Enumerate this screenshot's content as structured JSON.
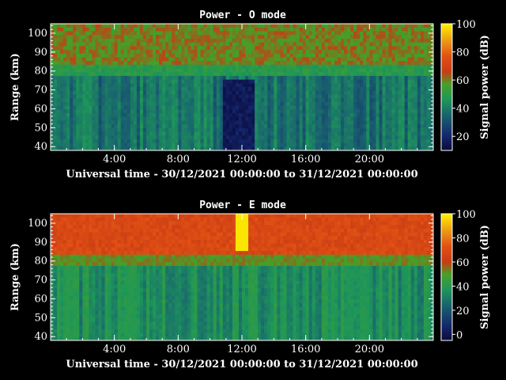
{
  "chart_data": [
    {
      "type": "heatmap",
      "title": "Power - O mode",
      "xlabel": "Universal time - 30/12/2021 00:00:00 to 31/12/2021 00:00:00",
      "ylabel": "Range (km)",
      "colorbar_label": "Signal power (dB)",
      "x_ticks": [
        "4:00",
        "8:00",
        "12:00",
        "16:00",
        "20:00"
      ],
      "x_tick_hours": [
        4,
        8,
        12,
        16,
        20
      ],
      "xlim_hours": [
        0,
        24
      ],
      "y_ticks": [
        40,
        50,
        60,
        70,
        80,
        90,
        100
      ],
      "ylim": [
        38,
        105
      ],
      "clim": [
        10,
        100
      ],
      "colorbar_ticks": [
        20,
        40,
        60,
        80,
        100
      ],
      "features": {
        "top_band_db": 60,
        "lower_region_db": 38,
        "dark_trough_hours": [
          10.8,
          12.8
        ],
        "dark_trough_db": 12
      }
    },
    {
      "type": "heatmap",
      "title": "Power - E mode",
      "xlabel": "Universal time - 30/12/2021 00:00:00 to 31/12/2021 00:00:00",
      "ylabel": "Range (km)",
      "colorbar_label": "Signal power (dB)",
      "x_ticks": [
        "4:00",
        "8:00",
        "12:00",
        "16:00",
        "20:00"
      ],
      "x_tick_hours": [
        4,
        8,
        12,
        16,
        20
      ],
      "xlim_hours": [
        0,
        24
      ],
      "y_ticks": [
        40,
        50,
        60,
        70,
        80,
        90,
        100
      ],
      "ylim": [
        38,
        105
      ],
      "clim": [
        -5,
        100
      ],
      "colorbar_ticks": [
        0,
        20,
        40,
        60,
        80,
        100
      ],
      "features": {
        "top_band_db": 68,
        "lower_region_db": 35,
        "spike_hour": 12.0,
        "spike_db": 98
      }
    }
  ],
  "colors": {
    "background": "#000000",
    "foreground": "#ffffff"
  }
}
